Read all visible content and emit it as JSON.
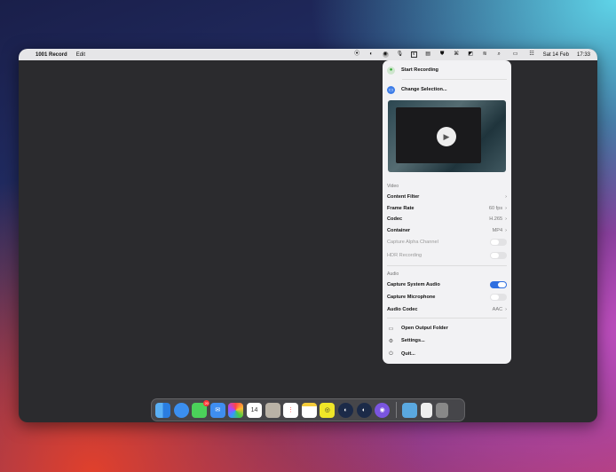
{
  "menubar": {
    "app_name": "1001 Record",
    "menu_edit": "Edit",
    "date": "Sat 14 Feb",
    "time": "17:33",
    "status_icons": [
      "record-status-icon",
      "steam-icon",
      "screen-record-icon",
      "microphone-icon",
      "v-icon",
      "control-icon",
      "shield-icon",
      "gamepad-icon",
      "cursor-icon",
      "wifi-icon",
      "search-icon",
      "battery-icon",
      "control-center-icon"
    ]
  },
  "panel": {
    "start_recording": "Start Recording",
    "change_selection": "Change Selection...",
    "video_header": "Video",
    "content_filter": "Content Filter",
    "frame_rate": "Frame Rate",
    "frame_rate_value": "60 fps",
    "codec": "Codec",
    "codec_value": "H.265",
    "container": "Container",
    "container_value": "MP4",
    "capture_alpha": "Capture Alpha Channel",
    "capture_alpha_on": false,
    "hdr": "HDR Recording",
    "hdr_on": false,
    "audio_header": "Audio",
    "capture_system_audio": "Capture System Audio",
    "capture_system_audio_on": true,
    "capture_microphone": "Capture Microphone",
    "capture_microphone_on": false,
    "audio_codec": "Audio Codec",
    "audio_codec_value": "AAC",
    "open_output": "Open Output Folder",
    "settings": "Settings...",
    "quit": "Quit..."
  },
  "dock": {
    "apps": [
      "Finder",
      "Safari",
      "Messages",
      "Mail",
      "Photos",
      "Calendar",
      "Contacts",
      "Reminders",
      "Notes",
      "App",
      "Steam",
      "Steam",
      "App",
      "Folder",
      "Document",
      "Trash"
    ],
    "calendar_day": "14",
    "messages_badge": "20"
  },
  "colors": {
    "accent": "#2f6fe0",
    "window_bg": "#2b2b2e"
  }
}
